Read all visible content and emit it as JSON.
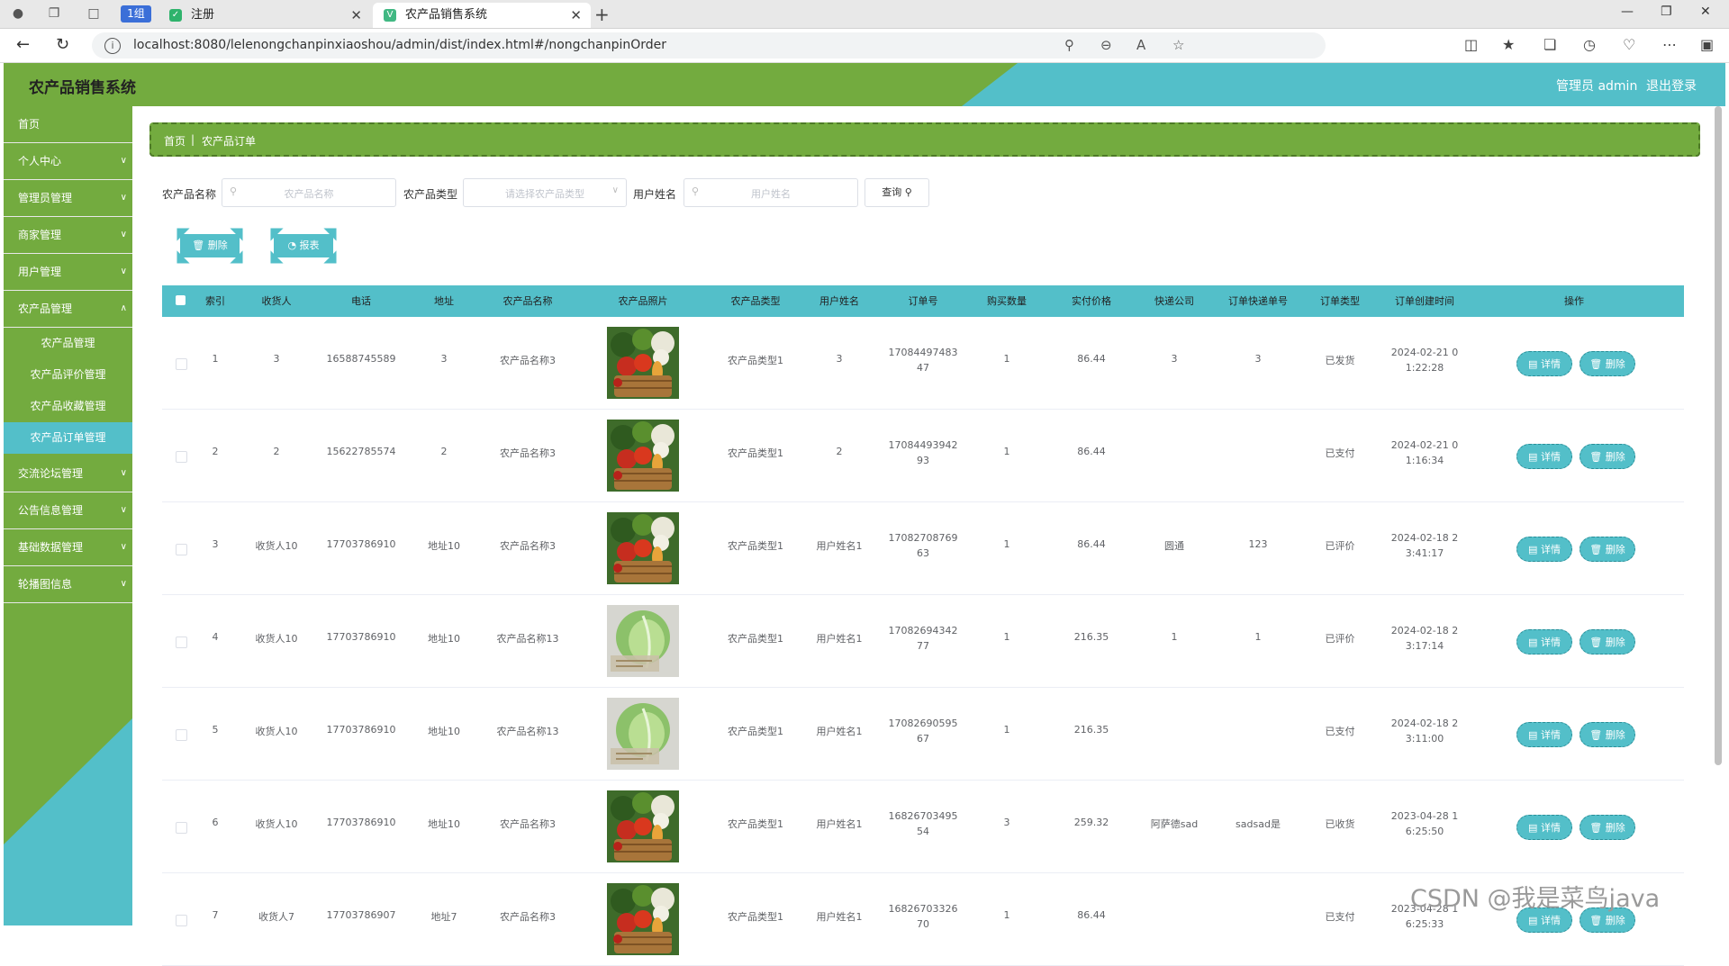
{
  "browser": {
    "group_chip": "1组",
    "inactive_tab": "注册",
    "active_tab": "农产品销售系统",
    "url": "localhost:8080/lelenongchanpinxiaoshou/admin/dist/index.html#/nongchanpinOrder"
  },
  "header": {
    "title": "农产品销售系统",
    "user": "管理员 admin",
    "logout": "退出登录"
  },
  "sidebar": {
    "items": [
      {
        "label": "首页"
      },
      {
        "label": "个人中心"
      },
      {
        "label": "管理员管理"
      },
      {
        "label": "商家管理"
      },
      {
        "label": "用户管理"
      },
      {
        "label": "农产品管理"
      },
      {
        "label": "交流论坛管理"
      },
      {
        "label": "公告信息管理"
      },
      {
        "label": "基础数据管理"
      },
      {
        "label": "轮播图信息"
      }
    ],
    "subitems": [
      {
        "label": "农产品管理"
      },
      {
        "label": "农产品评价管理"
      },
      {
        "label": "农产品收藏管理"
      },
      {
        "label": "农产品订单管理"
      }
    ]
  },
  "breadcrumb": {
    "home": "首页",
    "sep": "|",
    "current": "农产品订单"
  },
  "filters": {
    "name_label": "农产品名称",
    "name_placeholder": "农产品名称",
    "type_label": "农产品类型",
    "type_placeholder": "请选择农产品类型",
    "user_label": "用户姓名",
    "user_placeholder": "用户姓名",
    "query_button": "查询"
  },
  "actions": {
    "delete": "删除",
    "report": "报表"
  },
  "table": {
    "columns": [
      "索引",
      "收货人",
      "电话",
      "地址",
      "农产品名称",
      "农产品照片",
      "农产品类型",
      "用户姓名",
      "订单号",
      "购买数量",
      "实付价格",
      "快递公司",
      "订单快递单号",
      "订单类型",
      "订单创建时间",
      "操作"
    ],
    "detail_label": "详情",
    "delete_label": "删除",
    "rows": [
      {
        "idx": "1",
        "receiver": "3",
        "phone": "16588745589",
        "addr": "3",
        "pname": "农产品名称3",
        "photo": "basket",
        "ptype": "农产品类型1",
        "uname": "3",
        "order_no_1": "17084497483",
        "order_no_2": "47",
        "qty": "1",
        "price": "86.44",
        "courier": "3",
        "tracking": "3",
        "otype": "已发货",
        "time_1": "2024-02-21 0",
        "time_2": "1:22:28"
      },
      {
        "idx": "2",
        "receiver": "2",
        "phone": "15622785574",
        "addr": "2",
        "pname": "农产品名称3",
        "photo": "basket",
        "ptype": "农产品类型1",
        "uname": "2",
        "order_no_1": "17084493942",
        "order_no_2": "93",
        "qty": "1",
        "price": "86.44",
        "courier": "",
        "tracking": "",
        "otype": "已支付",
        "time_1": "2024-02-21 0",
        "time_2": "1:16:34"
      },
      {
        "idx": "3",
        "receiver": "收货人10",
        "phone": "17703786910",
        "addr": "地址10",
        "pname": "农产品名称3",
        "photo": "basket",
        "ptype": "农产品类型1",
        "uname": "用户姓名1",
        "order_no_1": "17082708769",
        "order_no_2": "63",
        "qty": "1",
        "price": "86.44",
        "courier": "圆通",
        "tracking": "123",
        "otype": "已评价",
        "time_1": "2024-02-18 2",
        "time_2": "3:41:17"
      },
      {
        "idx": "4",
        "receiver": "收货人10",
        "phone": "17703786910",
        "addr": "地址10",
        "pname": "农产品名称13",
        "photo": "cabbage",
        "ptype": "农产品类型1",
        "uname": "用户姓名1",
        "order_no_1": "17082694342",
        "order_no_2": "77",
        "qty": "1",
        "price": "216.35",
        "courier": "1",
        "tracking": "1",
        "otype": "已评价",
        "time_1": "2024-02-18 2",
        "time_2": "3:17:14"
      },
      {
        "idx": "5",
        "receiver": "收货人10",
        "phone": "17703786910",
        "addr": "地址10",
        "pname": "农产品名称13",
        "photo": "cabbage",
        "ptype": "农产品类型1",
        "uname": "用户姓名1",
        "order_no_1": "17082690595",
        "order_no_2": "67",
        "qty": "1",
        "price": "216.35",
        "courier": "",
        "tracking": "",
        "otype": "已支付",
        "time_1": "2024-02-18 2",
        "time_2": "3:11:00"
      },
      {
        "idx": "6",
        "receiver": "收货人10",
        "phone": "17703786910",
        "addr": "地址10",
        "pname": "农产品名称3",
        "photo": "basket",
        "ptype": "农产品类型1",
        "uname": "用户姓名1",
        "order_no_1": "16826703495",
        "order_no_2": "54",
        "qty": "3",
        "price": "259.32",
        "courier": "阿萨德sad",
        "tracking": "sadsad是",
        "otype": "已收货",
        "time_1": "2023-04-28 1",
        "time_2": "6:25:50"
      },
      {
        "idx": "7",
        "receiver": "收货人7",
        "phone": "17703786907",
        "addr": "地址7",
        "pname": "农产品名称3",
        "photo": "basket",
        "ptype": "农产品类型1",
        "uname": "用户姓名1",
        "order_no_1": "16826703326",
        "order_no_2": "70",
        "qty": "1",
        "price": "86.44",
        "courier": "",
        "tracking": "",
        "otype": "已支付",
        "time_1": "2023-04-28 1",
        "time_2": "6:25:33"
      }
    ]
  },
  "watermark": "CSDN @我是菜鸟java",
  "colors": {
    "green": "#73ab3f",
    "cyan": "#53bfc9"
  }
}
